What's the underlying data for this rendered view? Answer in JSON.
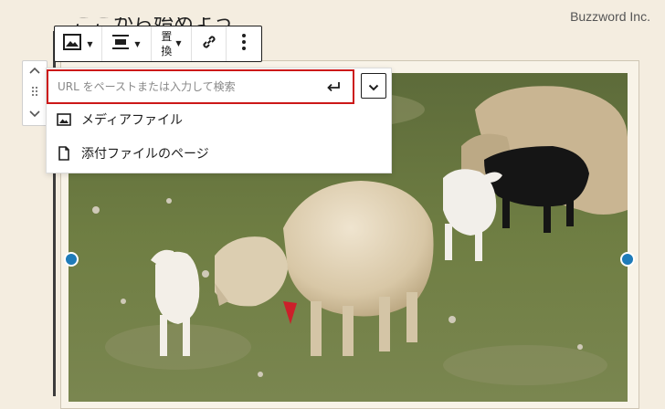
{
  "brand": "Buzzword Inc.",
  "heading_partial": "ここから始めよう",
  "toolbar": {
    "replace_label_line1": "置",
    "replace_label_line2": "換"
  },
  "popover": {
    "url_placeholder": "URL をペーストまたは入力して検索",
    "menu_items": [
      {
        "label": "メディアファイル",
        "icon": "image-icon"
      },
      {
        "label": "添付ファイルのページ",
        "icon": "page-icon"
      }
    ]
  },
  "colors": {
    "background": "#f4ede0",
    "accent_handle": "#1e7bb9",
    "focus_red": "#cc1818"
  }
}
